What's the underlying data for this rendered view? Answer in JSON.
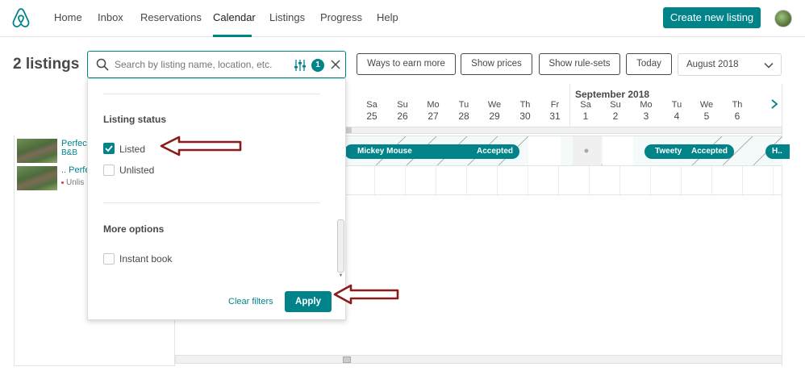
{
  "nav": {
    "items": [
      "Home",
      "Inbox",
      "Reservations",
      "Calendar",
      "Listings",
      "Progress",
      "Help"
    ],
    "active": "Calendar",
    "create_label": "Create new listing"
  },
  "toolbar": {
    "listings_count": "2 listings",
    "search_placeholder": "Search by listing name, location, etc.",
    "filter_count": "1",
    "buttons": [
      "Ways to earn more",
      "Show prices",
      "Show rule-sets",
      "Today"
    ],
    "month_value": "August 2018"
  },
  "listings": [
    {
      "title": "Perfec",
      "subtitle": "B&B"
    },
    {
      "title": ".. Perfe",
      "subtitle": "Unlis"
    }
  ],
  "calendar": {
    "month_label": "September 2018",
    "days": [
      {
        "name": "Sa",
        "date": "25"
      },
      {
        "name": "Su",
        "date": "26"
      },
      {
        "name": "Mo",
        "date": "27"
      },
      {
        "name": "Tu",
        "date": "28"
      },
      {
        "name": "We",
        "date": "29"
      },
      {
        "name": "Th",
        "date": "30"
      },
      {
        "name": "Fr",
        "date": "31"
      },
      {
        "name": "Sa",
        "date": "1"
      },
      {
        "name": "Su",
        "date": "2"
      },
      {
        "name": "Mo",
        "date": "3"
      },
      {
        "name": "Tu",
        "date": "4"
      },
      {
        "name": "We",
        "date": "5"
      },
      {
        "name": "Th",
        "date": "6"
      }
    ],
    "bookings": [
      {
        "guest": "Mickey Mouse",
        "status": "Accepted"
      },
      {
        "guest": "Tweety",
        "status": "Accepted"
      },
      {
        "guest": "H..",
        "status": ""
      }
    ]
  },
  "filter_panel": {
    "listing_status_heading": "Listing status",
    "listed_label": "Listed",
    "listed_checked": true,
    "unlisted_label": "Unlisted",
    "unlisted_checked": false,
    "more_options_heading": "More options",
    "instant_book_label": "Instant book",
    "instant_book_checked": false,
    "clear_label": "Clear filters",
    "apply_label": "Apply"
  },
  "colors": {
    "accent": "#00848a",
    "annotation_arrow": "#8b1a1a"
  }
}
